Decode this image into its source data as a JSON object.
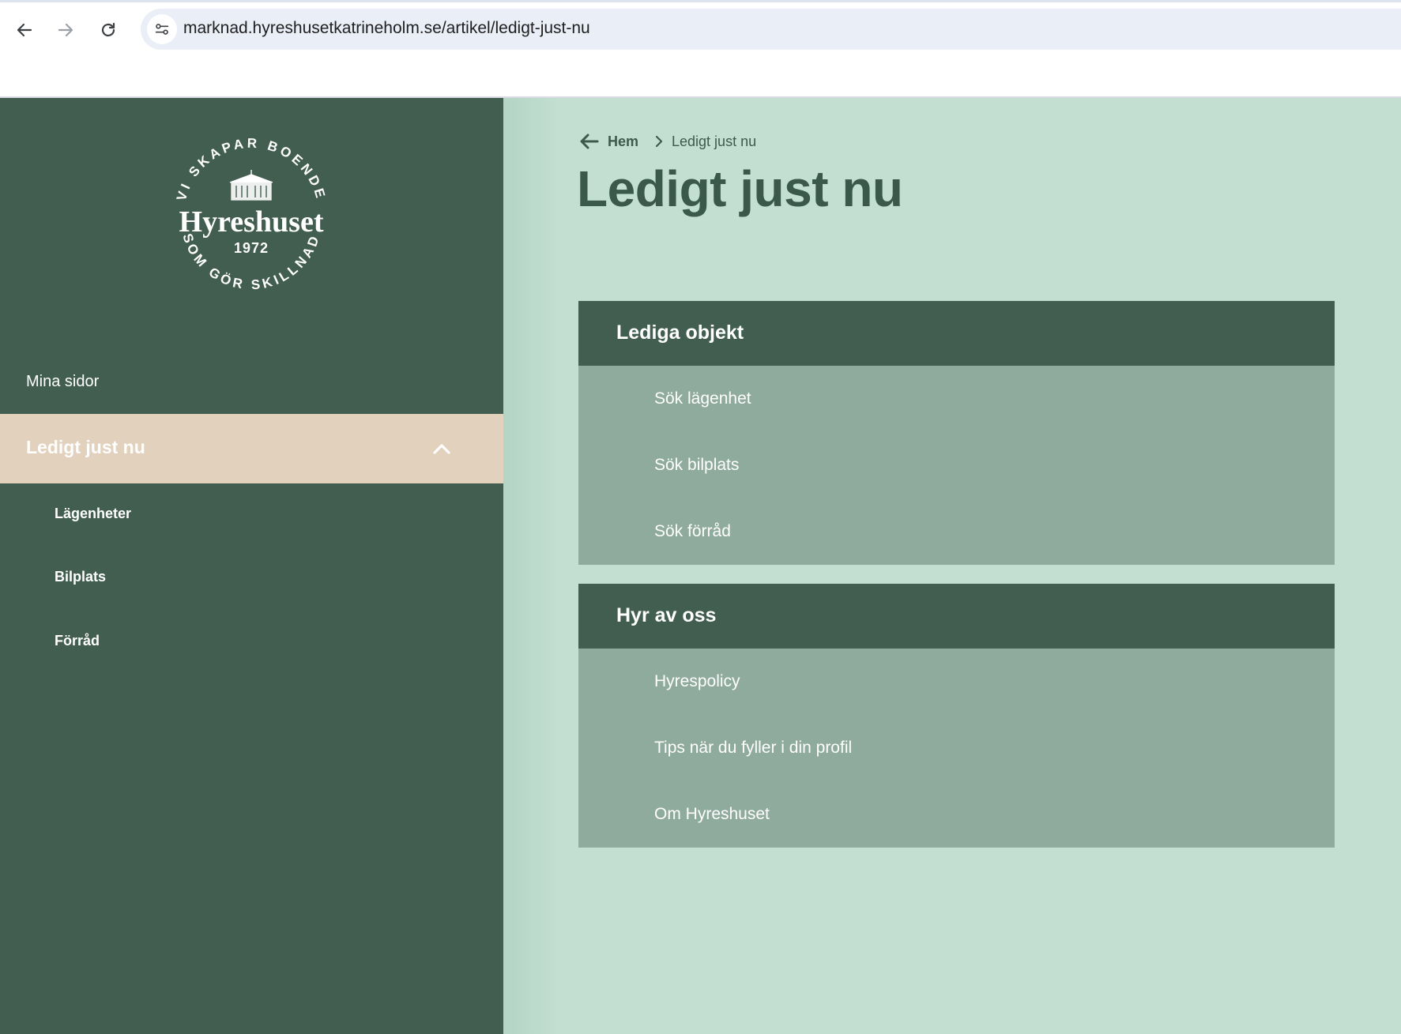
{
  "browser": {
    "url": "marknad.hyreshusetkatrineholm.se/artikel/ledigt-just-nu"
  },
  "logo": {
    "arc_top": "VI SKAPAR BOENDE",
    "brand": "Hyreshuset",
    "year": "1972",
    "arc_bottom": "SOM GÖR SKILLNAD"
  },
  "sidebar": {
    "mina_sidor": "Mina sidor",
    "active_label": "Ledigt just nu",
    "sub_items": [
      "Lägenheter",
      "Bilplats",
      "Förråd"
    ]
  },
  "breadcrumb": {
    "home": "Hem",
    "current": "Ledigt just nu"
  },
  "page": {
    "title": "Ledigt just nu"
  },
  "panels": [
    {
      "title": "Lediga objekt",
      "links": [
        "Sök lägenhet",
        "Sök bilplats",
        "Sök förråd"
      ]
    },
    {
      "title": "Hyr av oss",
      "links": [
        "Hyrespolicy",
        "Tips när du fyller i din profil",
        "Om Hyreshuset"
      ]
    }
  ],
  "colors": {
    "sidebar": "#415e50",
    "active_item": "#e2d1bd",
    "main_bg": "#c2dfd1",
    "panel_body": "#8fab9d",
    "title_text": "#3b594b"
  }
}
